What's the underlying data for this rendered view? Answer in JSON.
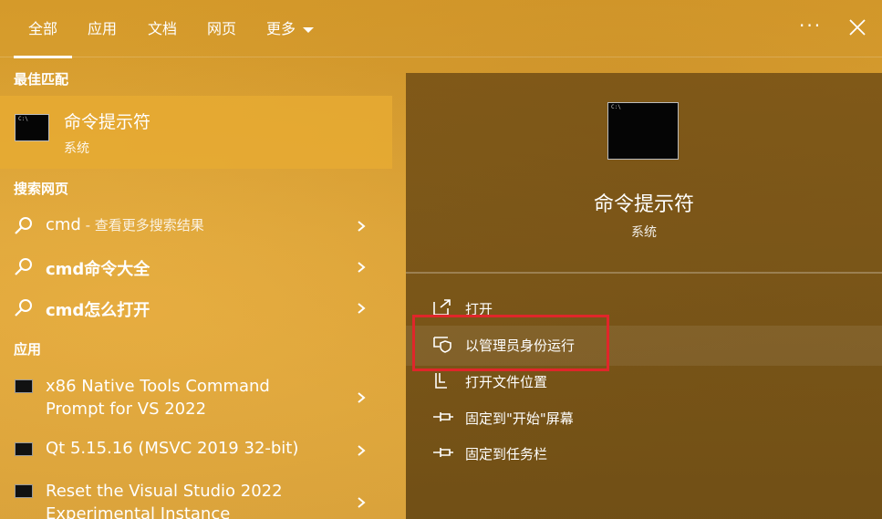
{
  "tabs": [
    "全部",
    "应用",
    "文档",
    "网页",
    "更多"
  ],
  "header": {
    "more_button": "···"
  },
  "left": {
    "best_match_title": "最佳匹配",
    "best_match": {
      "name": "命令提示符",
      "sub": "系统"
    },
    "web_title": "搜索网页",
    "web_results": [
      {
        "term": "cmd",
        "suffix": " - 查看更多搜索结果"
      },
      {
        "term": "cmd命令大全",
        "suffix": ""
      },
      {
        "term": "cmd怎么打开",
        "suffix": ""
      }
    ],
    "apps_title": "应用",
    "apps": [
      {
        "line1": "x86 Native Tools Command",
        "line2": "Prompt for VS 2022"
      },
      {
        "line1": "Qt 5.15.16 (MSVC 2019 32-bit)",
        "line2": ""
      },
      {
        "line1": "Reset the Visual Studio 2022",
        "line2": "Experimental Instance"
      }
    ]
  },
  "right": {
    "title": "命令提示符",
    "sub": "系统",
    "actions": [
      "打开",
      "以管理员身份运行",
      "打开文件位置",
      "固定到\"开始\"屏幕",
      "固定到任务栏"
    ]
  },
  "colors": {
    "accent": "#e0262a",
    "selected": "#e6aa32"
  }
}
